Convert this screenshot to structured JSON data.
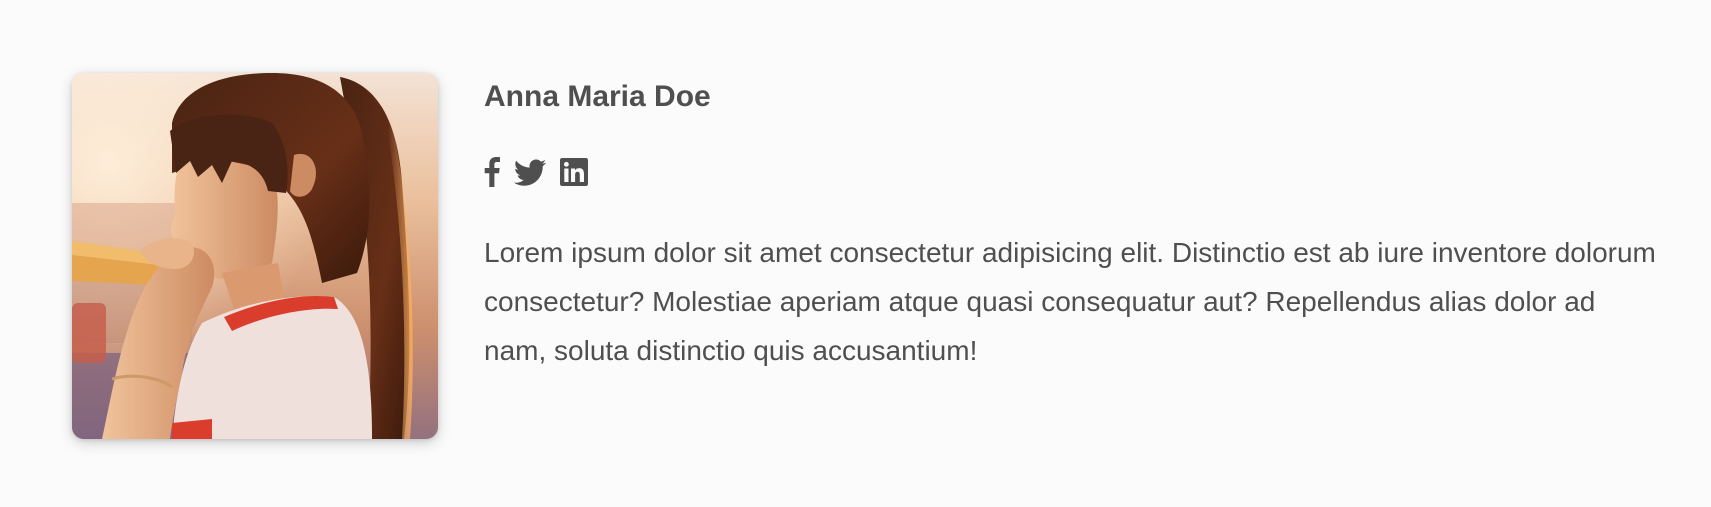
{
  "profile": {
    "name": "Anna Maria Doe",
    "photo_alt": "Anna Maria Doe",
    "bio": "Lorem ipsum dolor sit amet consectetur adipisicing elit. Distinctio est ab iure inventore dolorum consectetur? Molestiae aperiam atque quasi consequatur aut? Repellendus alias dolor ad nam, soluta distinctio quis accusantium!"
  },
  "socials": [
    {
      "icon": "facebook-icon"
    },
    {
      "icon": "twitter-icon"
    },
    {
      "icon": "linkedin-icon"
    }
  ],
  "colors": {
    "text": "#4f4f4f",
    "background": "#fbfbfb"
  }
}
